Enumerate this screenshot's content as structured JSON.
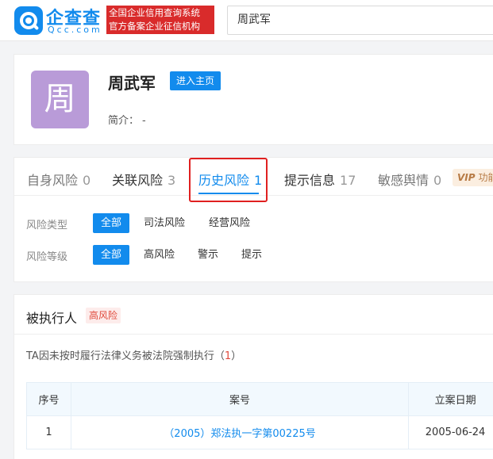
{
  "header": {
    "logo_name": "企查查",
    "logo_domain": "Qcc.com",
    "slogan_line1": "全国企业信用查询系统",
    "slogan_line2": "官方备案企业征信机构",
    "search_value": "周武军"
  },
  "profile": {
    "avatar_char": "周",
    "name": "周武军",
    "home_button": "进入主页",
    "intro_label": "简介：",
    "intro_value": "-"
  },
  "tabs": [
    {
      "label": "自身风险",
      "count": "0"
    },
    {
      "label": "关联风险",
      "count": "3"
    },
    {
      "label": "历史风险",
      "count": "1",
      "active": true
    },
    {
      "label": "提示信息",
      "count": "17"
    },
    {
      "label": "敏感舆情",
      "count": "0"
    }
  ],
  "vip": {
    "icon": "VIP",
    "text": "功能"
  },
  "filters": {
    "type": {
      "label": "风险类型",
      "options": [
        "全部",
        "司法风险",
        "经营风险"
      ],
      "selected": "全部"
    },
    "level": {
      "label": "风险等级",
      "options": [
        "全部",
        "高风险",
        "警示",
        "提示"
      ],
      "selected": "全部"
    }
  },
  "executed": {
    "title": "被执行人",
    "badge": "高风险",
    "subtitle": "TA因未按时履行法律义务被法院强制执行",
    "subtitle_count": "1",
    "table": {
      "headers": [
        "序号",
        "案号",
        "立案日期"
      ],
      "rows": [
        {
          "index": "1",
          "case_no": "（2005）郑法执一字第00225号",
          "date": "2005-06-24"
        }
      ]
    }
  },
  "colors": {
    "brand": "#128bed",
    "slogan_bg": "#d92b2b",
    "avatar_bg": "#b99bd8",
    "highlight": "#e02020",
    "high_risk": "#e04a3c"
  }
}
